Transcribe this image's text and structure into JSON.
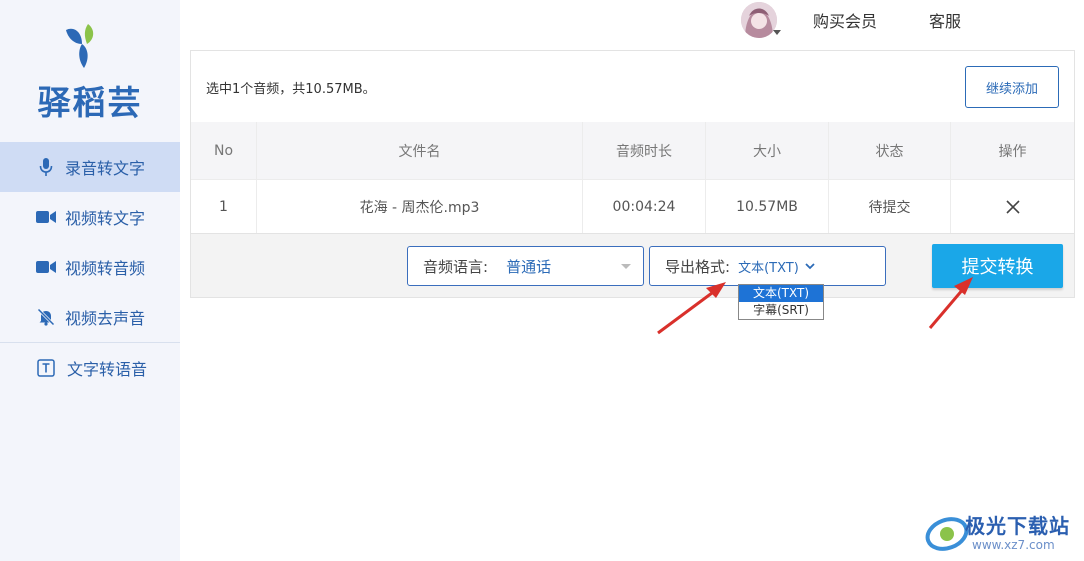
{
  "brand": {
    "name": "驿稻芸",
    "color": "#2c69b6"
  },
  "sidebar": {
    "items": [
      {
        "label": "录音转文字",
        "icon": "microphone-icon",
        "active": true
      },
      {
        "label": "视频转文字",
        "icon": "video-camera-icon",
        "active": false
      },
      {
        "label": "视频转音频",
        "icon": "video-camera-icon",
        "active": false
      },
      {
        "label": "视频去声音",
        "icon": "bell-off-icon",
        "active": false
      },
      {
        "label": "文字转语音",
        "icon": "text-box-icon",
        "active": false
      }
    ]
  },
  "header": {
    "buy_label": "购买会员",
    "service_label": "客服"
  },
  "main": {
    "summary": "选中1个音频，共10.57MB。",
    "continue_label": "继续添加",
    "table": {
      "headers": [
        "No",
        "文件名",
        "音频时长",
        "大小",
        "状态",
        "操作"
      ],
      "rows": [
        {
          "no": "1",
          "filename": "花海 - 周杰伦.mp3",
          "duration": "00:04:24",
          "size": "10.57MB",
          "status": "待提交",
          "action_icon": "close-icon"
        }
      ]
    }
  },
  "footer": {
    "language_label": "音频语言:",
    "language_value": "普通话",
    "format_label": "导出格式:",
    "format_value": "文本(TXT)",
    "format_options": [
      "文本(TXT)",
      "字幕(SRT)"
    ],
    "submit_label": "提交转换",
    "submit_color": "#1aa7e8"
  },
  "watermark": {
    "title": "极光下载站",
    "url": "www.xz7.com"
  }
}
